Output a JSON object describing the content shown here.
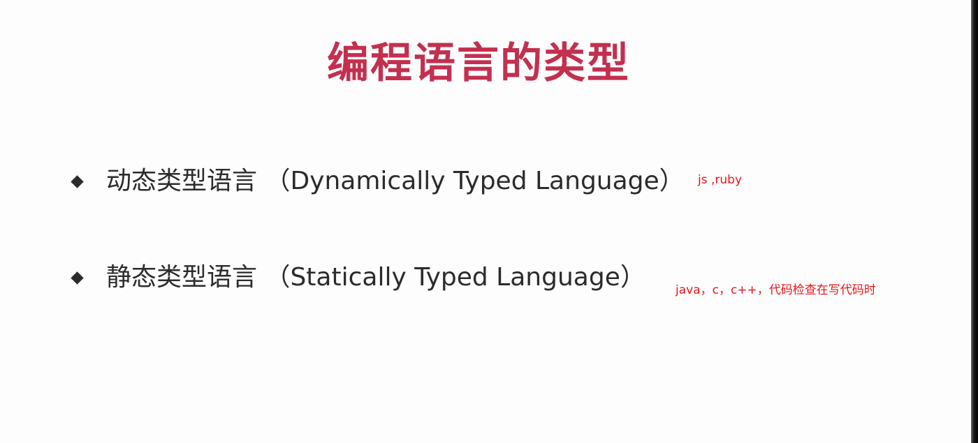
{
  "slide": {
    "title": "编程语言的类型",
    "bullets": [
      {
        "text": "动态类型语言 （Dynamically Typed Language）",
        "icon": "diamond-bullet-icon"
      },
      {
        "text": "静态类型语言 （Statically Typed Language）",
        "icon": "diamond-bullet-icon"
      }
    ],
    "annotations": [
      {
        "text": "js ,ruby",
        "color": "#e8151a"
      },
      {
        "text": "java，c，c++，代码检查在写代码时",
        "color": "#e8151a"
      }
    ],
    "colors": {
      "title": "#c3304f",
      "body_text": "#2b2b2b",
      "background": "#fdfdfd"
    }
  }
}
